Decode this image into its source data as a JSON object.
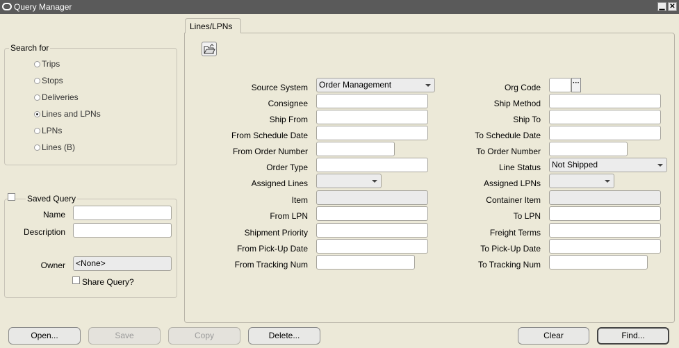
{
  "window": {
    "title": "Query Manager"
  },
  "search_for": {
    "label": "Search for",
    "options": [
      {
        "label": "Trips",
        "selected": false
      },
      {
        "label": "Stops",
        "selected": false
      },
      {
        "label": "Deliveries",
        "selected": false
      },
      {
        "label": "Lines and LPNs",
        "selected": true
      },
      {
        "label": "LPNs",
        "selected": false
      },
      {
        "label": "Lines (B)",
        "selected": false
      }
    ]
  },
  "saved_query": {
    "label": "Saved Query",
    "checked": false,
    "name_label": "Name",
    "name_value": "",
    "description_label": "Description",
    "description_value": "",
    "owner_label": "Owner",
    "owner_value": "<None>",
    "share_label": "Share Query?"
  },
  "tab": {
    "label": "Lines/LPNs"
  },
  "form": {
    "source_system": {
      "label": "Source System",
      "value": "Order Management"
    },
    "consignee": {
      "label": "Consignee",
      "value": ""
    },
    "ship_from": {
      "label": "Ship From",
      "value": ""
    },
    "from_schedule_date": {
      "label": "From Schedule Date",
      "value": ""
    },
    "from_order_number": {
      "label": "From Order Number",
      "value": ""
    },
    "order_type": {
      "label": "Order Type",
      "value": ""
    },
    "assigned_lines": {
      "label": "Assigned Lines",
      "value": ""
    },
    "item": {
      "label": "Item",
      "value": ""
    },
    "from_lpn": {
      "label": "From LPN",
      "value": ""
    },
    "shipment_priority": {
      "label": "Shipment Priority",
      "value": ""
    },
    "from_pickup_date": {
      "label": "From Pick-Up Date",
      "value": ""
    },
    "from_tracking_num": {
      "label": "From Tracking Num",
      "value": ""
    },
    "org_code": {
      "label": "Org Code",
      "value": ""
    },
    "ship_method": {
      "label": "Ship Method",
      "value": ""
    },
    "ship_to": {
      "label": "Ship To",
      "value": ""
    },
    "to_schedule_date": {
      "label": "To Schedule Date",
      "value": ""
    },
    "to_order_number": {
      "label": "To Order Number",
      "value": ""
    },
    "line_status": {
      "label": "Line Status",
      "value": "Not Shipped"
    },
    "assigned_lpns": {
      "label": "Assigned LPNs",
      "value": ""
    },
    "container_item": {
      "label": "Container Item",
      "value": ""
    },
    "to_lpn": {
      "label": "To LPN",
      "value": ""
    },
    "freight_terms": {
      "label": "Freight Terms",
      "value": ""
    },
    "to_pickup_date": {
      "label": "To Pick-Up Date",
      "value": ""
    },
    "to_tracking_num": {
      "label": "To Tracking Num",
      "value": ""
    }
  },
  "buttons": {
    "open": "Open...",
    "save": "Save",
    "copy": "Copy",
    "delete": "Delete...",
    "clear": "Clear",
    "find": "Find..."
  },
  "icons": {
    "window": "oracle-window-icon",
    "minimize": "minimize-icon",
    "close": "close-icon",
    "open_folder": "open-folder-icon",
    "lov": "ellipsis-icon"
  }
}
